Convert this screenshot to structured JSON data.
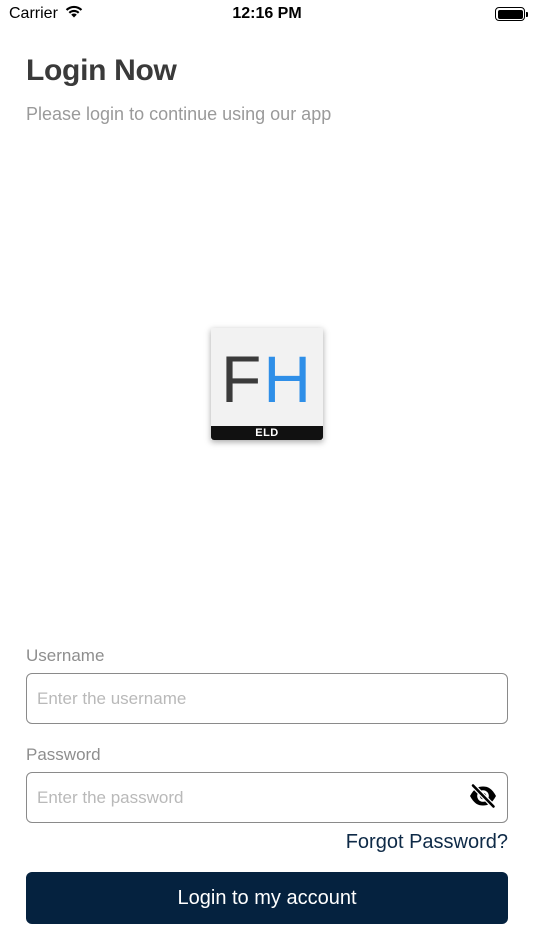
{
  "status_bar": {
    "carrier": "Carrier",
    "time": "12:16 PM",
    "battery_level": 1.0
  },
  "header": {
    "title": "Login Now",
    "subtitle": "Please login to continue using our app"
  },
  "logo": {
    "letter_1": "F",
    "letter_2": "H",
    "band_text": "ELD",
    "colors": {
      "f": "#3b3b3b",
      "h": "#2f8fe8",
      "band": "#111111"
    }
  },
  "form": {
    "username": {
      "label": "Username",
      "value": "",
      "placeholder": "Enter the username"
    },
    "password": {
      "label": "Password",
      "value": "",
      "placeholder": "Enter the password",
      "toggle_icon": "eye-slash-icon"
    },
    "forgot_label": "Forgot Password?",
    "submit_label": "Login to my account"
  },
  "colors": {
    "primary": "#05223f",
    "link": "#0e2a47",
    "label": "#8e8e8e",
    "placeholder": "#b9b9b9"
  }
}
